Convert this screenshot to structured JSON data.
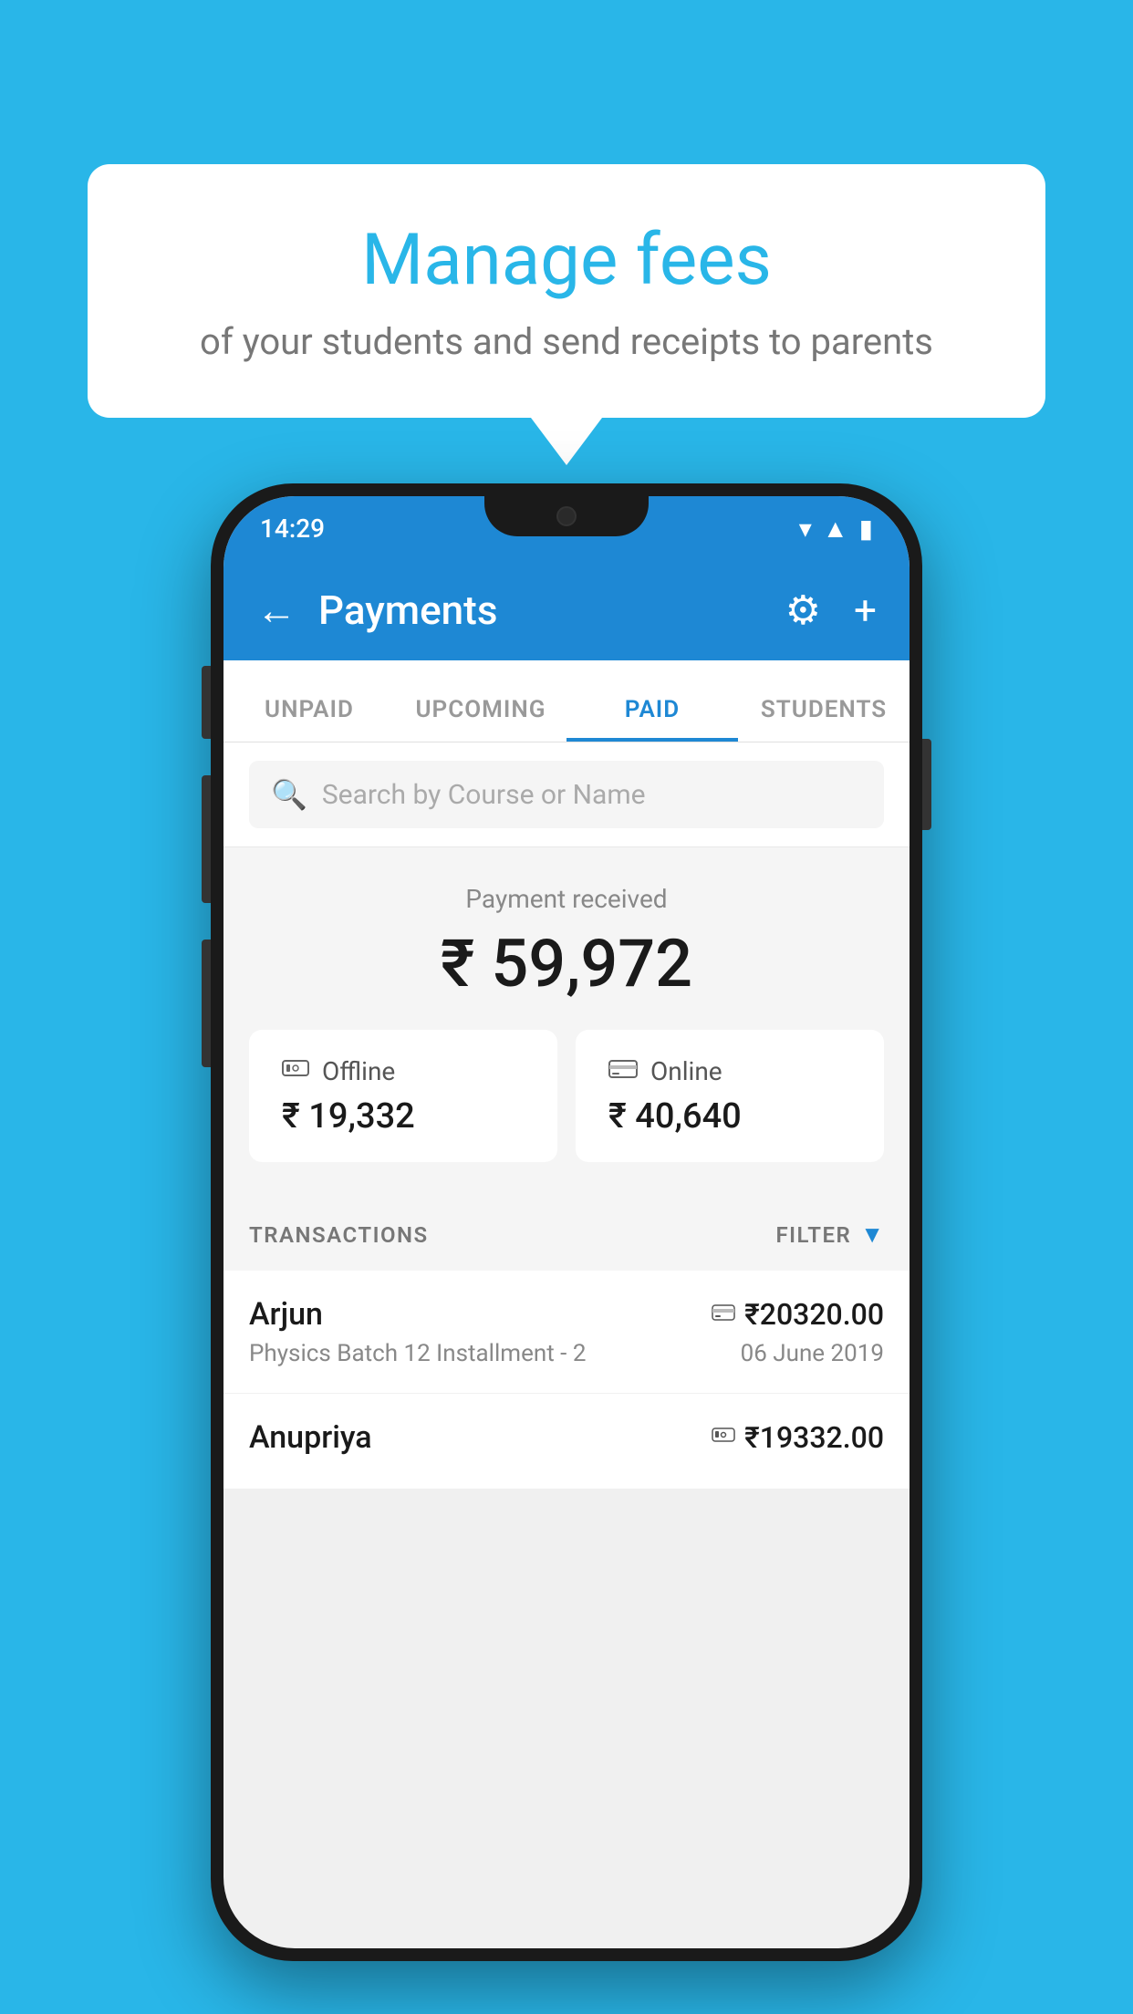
{
  "hero": {
    "title": "Manage fees",
    "subtitle": "of your students and send receipts to parents"
  },
  "status_bar": {
    "time": "14:29"
  },
  "header": {
    "title": "Payments",
    "back_label": "←",
    "settings_label": "⚙",
    "add_label": "+"
  },
  "tabs": [
    {
      "label": "UNPAID",
      "active": false
    },
    {
      "label": "UPCOMING",
      "active": false
    },
    {
      "label": "PAID",
      "active": true
    },
    {
      "label": "STUDENTS",
      "active": false
    }
  ],
  "search": {
    "placeholder": "Search by Course or Name"
  },
  "payment_summary": {
    "label": "Payment received",
    "amount": "₹ 59,972",
    "offline": {
      "icon": "💳",
      "label": "Offline",
      "amount": "₹ 19,332"
    },
    "online": {
      "icon": "💳",
      "label": "Online",
      "amount": "₹ 40,640"
    }
  },
  "transactions": {
    "label": "TRANSACTIONS",
    "filter_label": "FILTER",
    "rows": [
      {
        "name": "Arjun",
        "amount": "₹20320.00",
        "course": "Physics Batch 12 Installment - 2",
        "date": "06 June 2019",
        "payment_type": "online"
      },
      {
        "name": "Anupriya",
        "amount": "₹19332.00",
        "course": "",
        "date": "",
        "payment_type": "offline"
      }
    ]
  }
}
